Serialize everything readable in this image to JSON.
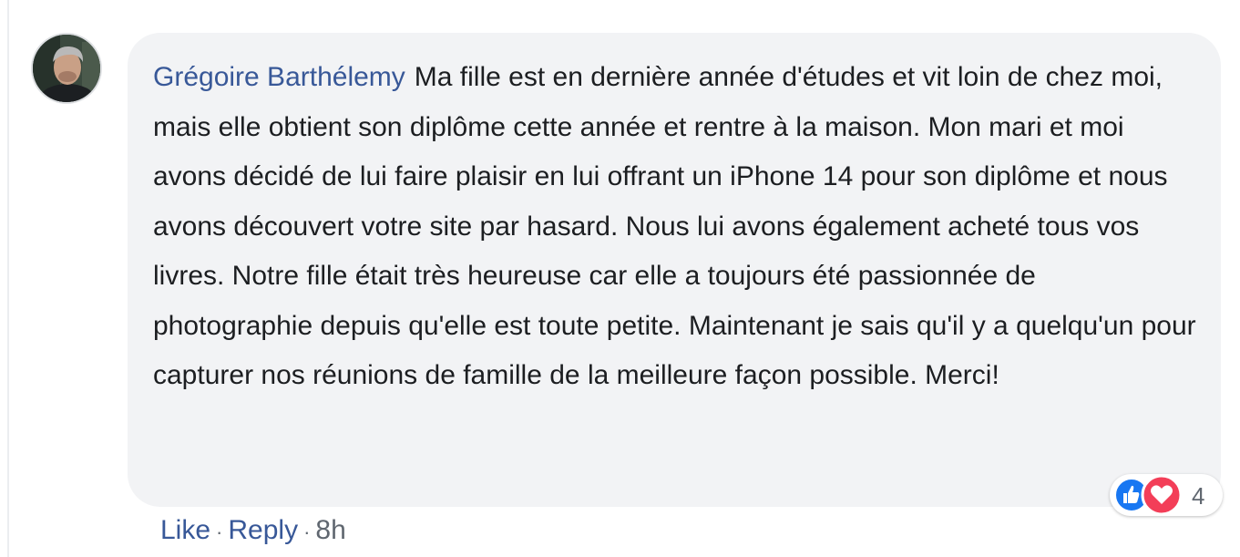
{
  "comment": {
    "author": "Grégoire Barthélemy",
    "text": "Ma fille est en dernière année d'études et vit loin de chez moi, mais elle obtient son diplôme cette année et rentre à la maison. Mon mari et moi avons décidé de lui faire plaisir en lui offrant un iPhone 14 pour son diplôme et nous avons découvert votre site par hasard. Nous lui avons également acheté tous vos livres. Notre fille était très heureuse car elle a toujours été passionnée de photographie depuis qu'elle est toute petite. Maintenant je sais qu'il y a quelqu'un pour capturer nos réunions de famille de la meilleure façon possible. Merci!",
    "reactions": {
      "icons": [
        "like-icon",
        "love-icon"
      ],
      "count": "4"
    },
    "actions": {
      "like_label": "Like",
      "reply_label": "Reply",
      "separator": "·",
      "timestamp": "8h"
    }
  },
  "colors": {
    "link": "#385898",
    "text": "#1c1e21",
    "bubble": "#f2f3f5",
    "muted": "#606770",
    "like_blue": "#1877f2",
    "love_red": "#f33e58"
  }
}
